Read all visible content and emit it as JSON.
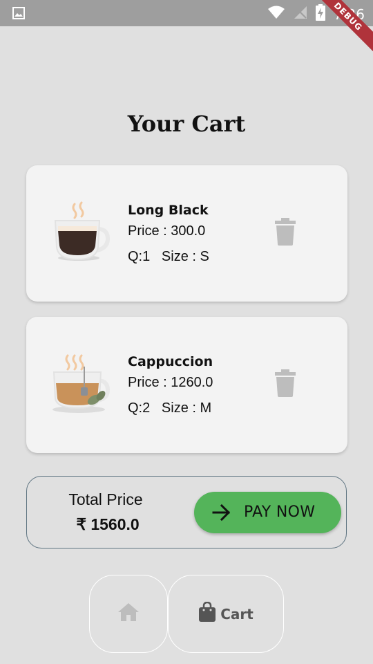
{
  "status_bar": {
    "time": "7:26",
    "debug_label": "DEBUG",
    "icons": [
      "image-icon",
      "wifi-icon",
      "no-signal-icon",
      "battery-charging-icon"
    ]
  },
  "page": {
    "title": "Your Cart"
  },
  "cart_items": [
    {
      "name": "Long Black",
      "price": "Price : 300.0",
      "qty_size": "Q:1   Size : S",
      "image_icon": "long-black-coffee-icon",
      "delete_icon": "trash-icon"
    },
    {
      "name": "Cappuccion",
      "price": "Price : 1260.0",
      "qty_size": "Q:2   Size : M",
      "image_icon": "tea-cup-icon",
      "delete_icon": "trash-icon"
    }
  ],
  "total": {
    "label": "Total Price",
    "value": "₹ 1560.0"
  },
  "pay_button": {
    "label": "PAY NOW",
    "icon": "arrow-right-icon",
    "color": "#54b45a"
  },
  "bottom_nav": {
    "home_icon": "home-icon",
    "cart_icon": "shopping-bag-icon",
    "cart_label": "Cart"
  },
  "colors": {
    "background": "#e0e0e0",
    "card": "#f3f3f3",
    "status_bar": "#9e9e9e",
    "debug_banner": "#b0333b",
    "panel_border": "#5d7380"
  }
}
